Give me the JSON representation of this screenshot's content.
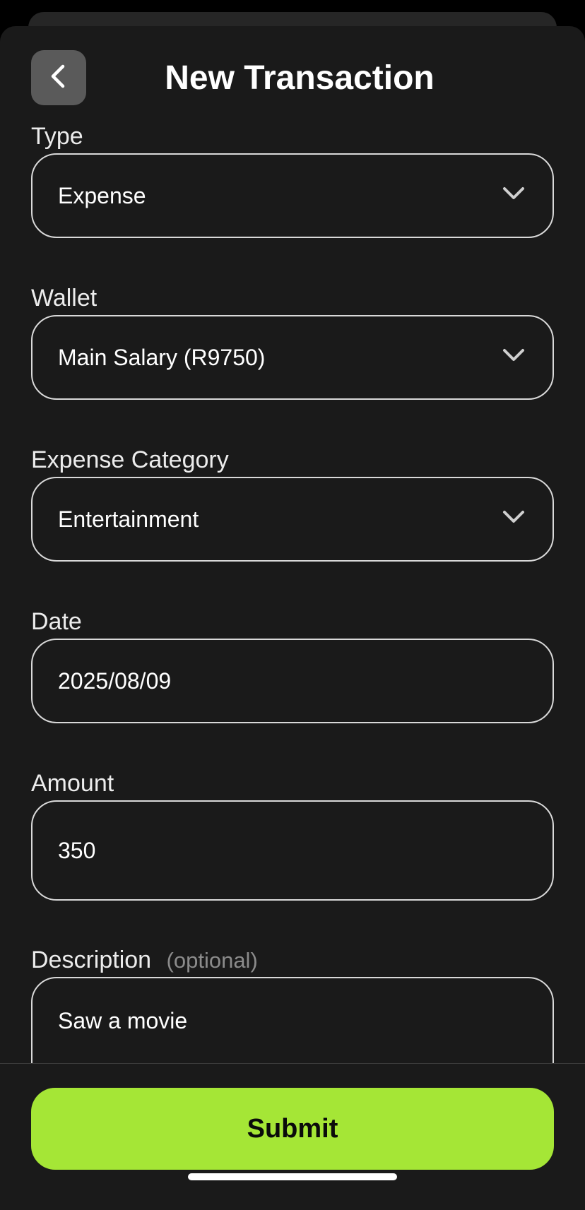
{
  "header": {
    "title": "New Transaction",
    "back_icon": "chevron-left-icon"
  },
  "form": {
    "type": {
      "label": "Type",
      "value": "Expense",
      "icon": "chevron-down-icon"
    },
    "wallet": {
      "label": "Wallet",
      "value": "Main Salary (R9750)",
      "icon": "chevron-down-icon"
    },
    "category": {
      "label": "Expense Category",
      "value": "Entertainment",
      "icon": "chevron-down-icon"
    },
    "date": {
      "label": "Date",
      "value": "2025/08/09"
    },
    "amount": {
      "label": "Amount",
      "value": "350"
    },
    "description": {
      "label": "Description",
      "optional_hint": "(optional)",
      "value": "Saw a movie"
    }
  },
  "footer": {
    "submit_label": "Submit"
  },
  "colors": {
    "background": "#1a1a1a",
    "accent": "#a5e636",
    "field_border": "#d9d9d9",
    "back_button": "#5a5a5a"
  }
}
